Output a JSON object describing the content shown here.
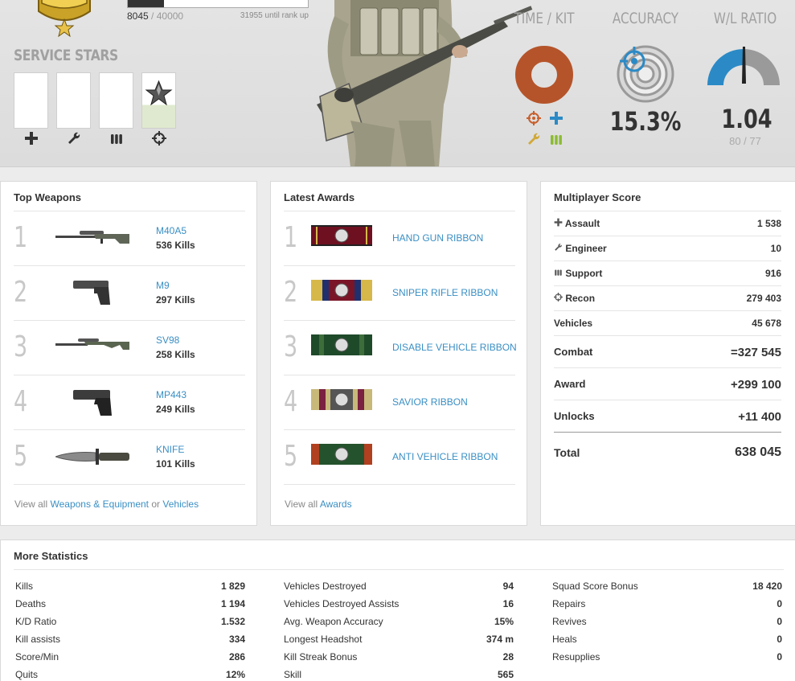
{
  "rank": {
    "progress_current": "8045",
    "progress_total": "/ 40000",
    "progress_fraction": 0.2011,
    "until_next": "31955 until rank up"
  },
  "service_stars": {
    "title": "SERVICE STARS",
    "slots": [
      {
        "icon": "plus-icon",
        "earned": false
      },
      {
        "icon": "wrench-icon",
        "earned": false
      },
      {
        "icon": "ammo-icon",
        "earned": false
      },
      {
        "icon": "crosshair-icon",
        "earned": true
      }
    ]
  },
  "kpis": {
    "time_kit": {
      "title": "TIME / KIT"
    },
    "accuracy": {
      "title": "ACCURACY",
      "value": "15.3%"
    },
    "wl_ratio": {
      "title": "W/L RATIO",
      "value": "1.04",
      "sub": "80 / 77"
    }
  },
  "colors": {
    "link": "#3a8fc4",
    "kit_ring": "#b5542a",
    "accent_blue": "#2b8ac6",
    "support_green": "#8cbb32"
  },
  "top_weapons": {
    "title": "Top Weapons",
    "items": [
      {
        "rank": "1",
        "name": "M40A5",
        "kills": "536 Kills"
      },
      {
        "rank": "2",
        "name": "M9",
        "kills": "297 Kills"
      },
      {
        "rank": "3",
        "name": "SV98",
        "kills": "258 Kills"
      },
      {
        "rank": "4",
        "name": "MP443",
        "kills": "249 Kills"
      },
      {
        "rank": "5",
        "name": "KNIFE",
        "kills": "101 Kills"
      }
    ],
    "footer_prefix": "View all",
    "footer_link1": "Weapons & Equipment",
    "footer_or": "or",
    "footer_link2": "Vehicles"
  },
  "latest_awards": {
    "title": "Latest Awards",
    "items": [
      {
        "rank": "1",
        "name": "HAND GUN RIBBON"
      },
      {
        "rank": "2",
        "name": "SNIPER RIFLE RIBBON"
      },
      {
        "rank": "3",
        "name": "DISABLE VEHICLE RIBBON"
      },
      {
        "rank": "4",
        "name": "SAVIOR RIBBON"
      },
      {
        "rank": "5",
        "name": "ANTI VEHICLE RIBBON"
      }
    ],
    "footer_prefix": "View all",
    "footer_link": "Awards"
  },
  "multiplayer_score": {
    "title": "Multiplayer Score",
    "rows": [
      {
        "label": "Assault",
        "value": "1 538",
        "icon": "plus-icon"
      },
      {
        "label": "Engineer",
        "value": "10",
        "icon": "wrench-icon"
      },
      {
        "label": "Support",
        "value": "916",
        "icon": "ammo-icon"
      },
      {
        "label": "Recon",
        "value": "279 403",
        "icon": "crosshair-icon"
      },
      {
        "label": "Vehicles",
        "value": "45 678"
      },
      {
        "label": "Combat",
        "value": "=327 545"
      },
      {
        "label": "Award",
        "value": "+299 100"
      },
      {
        "label": "Unlocks",
        "value": "+11 400"
      }
    ],
    "total_label": "Total",
    "total_value": "638 045"
  },
  "more_statistics": {
    "title": "More Statistics",
    "col1": [
      {
        "label": "Kills",
        "value": "1 829"
      },
      {
        "label": "Deaths",
        "value": "1 194"
      },
      {
        "label": "K/D Ratio",
        "value": "1.532"
      },
      {
        "label": "Kill assists",
        "value": "334"
      },
      {
        "label": "Score/Min",
        "value": "286"
      },
      {
        "label": "Quits",
        "value": "12%"
      }
    ],
    "col2": [
      {
        "label": "Vehicles Destroyed",
        "value": "94"
      },
      {
        "label": "Vehicles Destroyed Assists",
        "value": "16"
      },
      {
        "label": "Avg. Weapon Accuracy",
        "value": "15%"
      },
      {
        "label": "Longest Headshot",
        "value": "374 m"
      },
      {
        "label": "Kill Streak Bonus",
        "value": "28"
      },
      {
        "label": "Skill",
        "value": "565"
      }
    ],
    "col3": [
      {
        "label": "Squad Score Bonus",
        "value": "18 420"
      },
      {
        "label": "Repairs",
        "value": "0"
      },
      {
        "label": "Revives",
        "value": "0"
      },
      {
        "label": "Heals",
        "value": "0"
      },
      {
        "label": "Resupplies",
        "value": "0"
      }
    ]
  }
}
